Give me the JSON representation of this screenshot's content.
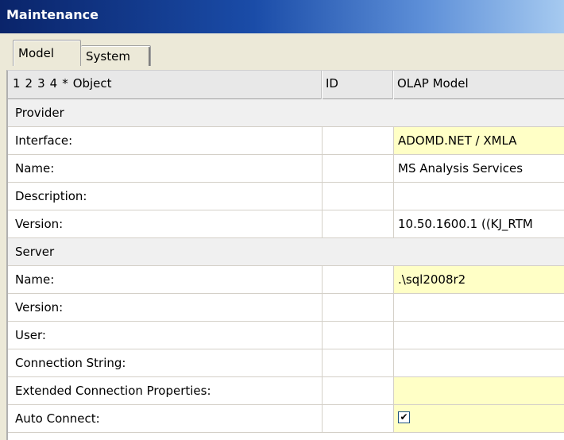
{
  "window": {
    "title": "Maintenance"
  },
  "tabs": [
    {
      "label": "Model",
      "active": true
    },
    {
      "label": "System",
      "active": false
    }
  ],
  "grid": {
    "level_buttons": [
      "1",
      "2",
      "3",
      "4",
      "*"
    ],
    "columns": {
      "object": "Object",
      "id": "ID",
      "olap": "OLAP Model"
    },
    "rows": [
      {
        "type": "section",
        "label": "Provider"
      },
      {
        "type": "field",
        "label": "Interface:",
        "id": "",
        "value": "ADOMD.NET / XMLA",
        "highlight": true
      },
      {
        "type": "field",
        "label": "Name:",
        "id": "",
        "value": "MS Analysis Services",
        "highlight": false
      },
      {
        "type": "field",
        "label": "Description:",
        "id": "",
        "value": "",
        "highlight": false
      },
      {
        "type": "field",
        "label": "Version:",
        "id": "",
        "value": "10.50.1600.1 ((KJ_RTM",
        "highlight": false
      },
      {
        "type": "section",
        "label": "Server"
      },
      {
        "type": "field",
        "label": "Name:",
        "id": "",
        "value": ".\\sql2008r2",
        "highlight": true
      },
      {
        "type": "field",
        "label": "Version:",
        "id": "",
        "value": "",
        "highlight": false
      },
      {
        "type": "field",
        "label": "User:",
        "id": "",
        "value": "",
        "highlight": false
      },
      {
        "type": "field",
        "label": "Connection String:",
        "id": "",
        "value": "",
        "highlight": false
      },
      {
        "type": "field",
        "label": "Extended Connection Properties:",
        "id": "",
        "value": "",
        "highlight": true
      },
      {
        "type": "field",
        "label": "Auto Connect:",
        "id": "",
        "value": "",
        "checked": true,
        "highlight": true
      }
    ]
  },
  "colors": {
    "highlight": "#ffffc6",
    "titlebar": "#0a246a"
  }
}
